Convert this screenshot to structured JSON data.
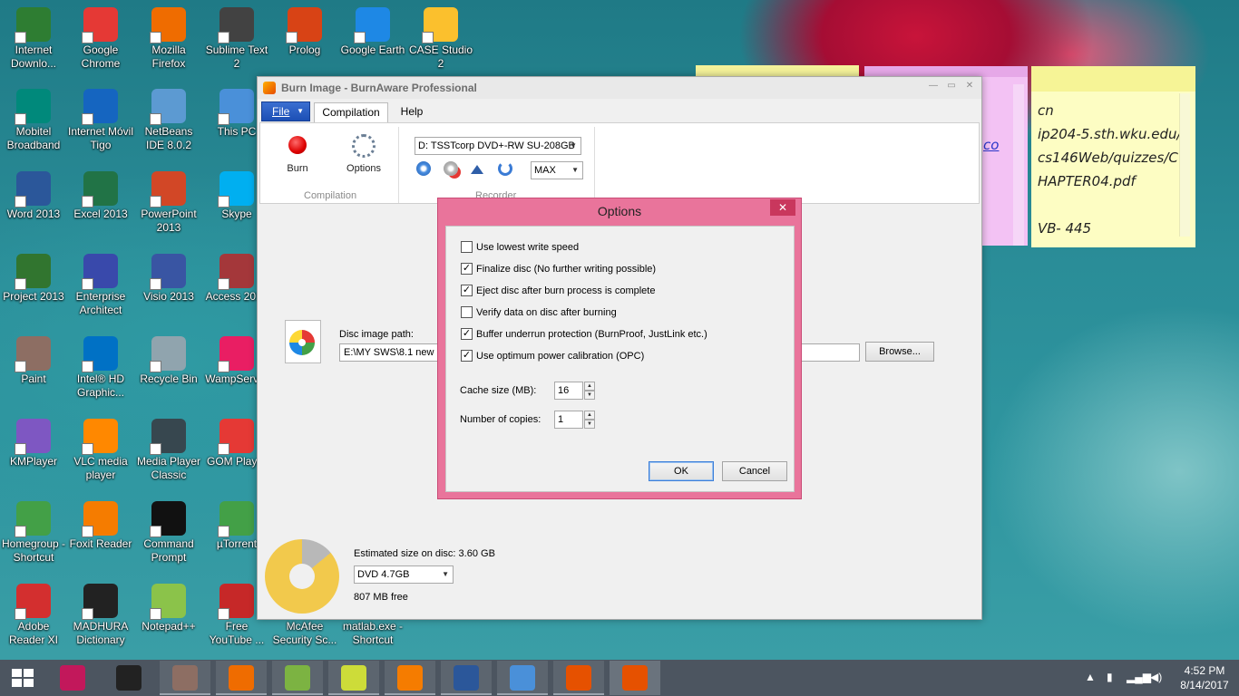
{
  "desktop": {
    "icons": [
      {
        "label": "Internet Downlo...",
        "icon": "idm-icon",
        "color": "#2e7d32"
      },
      {
        "label": "Google Chrome",
        "icon": "chrome-icon",
        "color": "#e53935"
      },
      {
        "label": "Mozilla Firefox",
        "icon": "firefox-icon",
        "color": "#ef6c00"
      },
      {
        "label": "Sublime Text 2",
        "icon": "sublime-icon",
        "color": "#424242"
      },
      {
        "label": "Prolog",
        "icon": "prolog-owl-icon",
        "color": "#d84315"
      },
      {
        "label": "Google Earth",
        "icon": "google-earth-icon",
        "color": "#1e88e5"
      },
      {
        "label": "CASE Studio 2",
        "icon": "case-studio-icon",
        "color": "#fbc02d"
      },
      {
        "label": "Mobitel Broadband",
        "icon": "mobitel-icon",
        "color": "#00897b"
      },
      {
        "label": "Internet Móvil Tigo",
        "icon": "tigo-icon",
        "color": "#1565c0"
      },
      {
        "label": "NetBeans IDE 8.0.2",
        "icon": "netbeans-icon",
        "color": "#5c9ad2"
      },
      {
        "label": "This PC",
        "icon": "this-pc-icon",
        "color": "#4a90d9"
      },
      {
        "label": "Word 2013",
        "icon": "word-icon",
        "color": "#2b579a"
      },
      {
        "label": "Excel 2013",
        "icon": "excel-icon",
        "color": "#217346"
      },
      {
        "label": "PowerPoint 2013",
        "icon": "powerpoint-icon",
        "color": "#d24726"
      },
      {
        "label": "Skype",
        "icon": "skype-icon",
        "color": "#00aff0"
      },
      {
        "label": "Project 2013",
        "icon": "project-icon",
        "color": "#31752f"
      },
      {
        "label": "Enterprise Architect",
        "icon": "enterprise-architect-icon",
        "color": "#3949ab"
      },
      {
        "label": "Visio 2013",
        "icon": "visio-icon",
        "color": "#3955a3"
      },
      {
        "label": "Access 2013",
        "icon": "access-icon",
        "color": "#a4373a"
      },
      {
        "label": "Paint",
        "icon": "paint-icon",
        "color": "#8d6e63"
      },
      {
        "label": "Intel® HD Graphic...",
        "icon": "intel-graphics-icon",
        "color": "#0071c5"
      },
      {
        "label": "Recycle Bin",
        "icon": "recycle-bin-icon",
        "color": "#90a4ae"
      },
      {
        "label": "WampServer",
        "icon": "wampserver-icon",
        "color": "#e91e63"
      },
      {
        "label": "KMPlayer",
        "icon": "kmplayer-icon",
        "color": "#7e57c2"
      },
      {
        "label": "VLC media player",
        "icon": "vlc-icon",
        "color": "#ff8800"
      },
      {
        "label": "Media Player Classic",
        "icon": "media-player-classic-icon",
        "color": "#37474f"
      },
      {
        "label": "GOM Player",
        "icon": "gom-player-icon",
        "color": "#e53935"
      },
      {
        "label": "Homegroup - Shortcut",
        "icon": "homegroup-icon",
        "color": "#43a047"
      },
      {
        "label": "Foxit Reader",
        "icon": "foxit-icon",
        "color": "#f57c00"
      },
      {
        "label": "Command Prompt",
        "icon": "command-prompt-icon",
        "color": "#111111"
      },
      {
        "label": "µTorrent",
        "icon": "utorrent-icon",
        "color": "#43a047"
      },
      {
        "label": "Adobe Reader XI",
        "icon": "adobe-reader-icon",
        "color": "#d32f2f"
      },
      {
        "label": "MADHURA Dictionary",
        "icon": "madhura-dictionary-icon",
        "color": "#222222"
      },
      {
        "label": "Notepad++",
        "icon": "notepadpp-icon",
        "color": "#8bc34a"
      },
      {
        "label": "Free YouTube ...",
        "icon": "free-youtube-icon",
        "color": "#c62828"
      },
      {
        "label": "McAfee Security Sc...",
        "icon": "mcafee-icon",
        "color": "#c62828"
      },
      {
        "label": "matlab.exe - Shortcut",
        "icon": "matlab-icon",
        "color": "#e65100"
      }
    ]
  },
  "sticky_notes": {
    "pink_link": "co",
    "yellow_text": "cn\nip204-5.sth.wku.edu/cs146Web/quizzes/CHAPTER04.pdf\n\nVB- 445"
  },
  "app": {
    "title": "Burn Image - BurnAware Professional",
    "menu": {
      "file": "File",
      "tabs": [
        "Compilation",
        "Help"
      ]
    },
    "ribbon": {
      "burn": "Burn",
      "options": "Options",
      "compilation_group": "Compilation",
      "recorder_group": "Recorder",
      "drive": "D: TSSTcorp DVD+-RW SU-208GB",
      "speed": "MAX"
    },
    "disc_image_label": "Disc image path:",
    "disc_image_path": "E:\\MY SWS\\8.1 new O",
    "browse": "Browse...",
    "estimated_size": "Estimated size on disc: 3.60 GB",
    "disc_type": "DVD 4.7GB",
    "free_space": "807 MB free",
    "usage_fraction": 0.86
  },
  "options_dialog": {
    "title": "Options",
    "close": "✕",
    "checkboxes": [
      {
        "label": "Use lowest write speed",
        "checked": false
      },
      {
        "label": "Finalize disc (No further writing possible)",
        "checked": true
      },
      {
        "label": "Eject disc after burn process is complete",
        "checked": true
      },
      {
        "label": "Verify data on disc after burning",
        "checked": false
      },
      {
        "label": "Buffer underrun protection (BurnProof, JustLink etc.)",
        "checked": true
      },
      {
        "label": "Use optimum power calibration (OPC)",
        "checked": true
      }
    ],
    "cache_label": "Cache size (MB):",
    "cache_value": "16",
    "copies_label": "Number of copies:",
    "copies_value": "1",
    "ok": "OK",
    "cancel": "Cancel"
  },
  "taskbar": {
    "items": [
      {
        "icon": "snipping-tool-icon",
        "color": "#c2185b"
      },
      {
        "icon": "madhura-dictionary-icon",
        "color": "#222222"
      },
      {
        "icon": "paint-icon",
        "color": "#8d6e63"
      },
      {
        "icon": "firefox-icon",
        "color": "#ef6c00"
      },
      {
        "icon": "clover-icon",
        "color": "#7cb342"
      },
      {
        "icon": "sticky-notes-icon",
        "color": "#cddc39"
      },
      {
        "icon": "foxit-icon",
        "color": "#f57c00"
      },
      {
        "icon": "word-icon",
        "color": "#2b579a"
      },
      {
        "icon": "photos-icon",
        "color": "#4a90d9"
      },
      {
        "icon": "burnaware-icon",
        "color": "#e65100"
      },
      {
        "icon": "burnaware-icon",
        "color": "#e65100"
      }
    ],
    "time": "4:52 PM",
    "date": "8/14/2017"
  }
}
